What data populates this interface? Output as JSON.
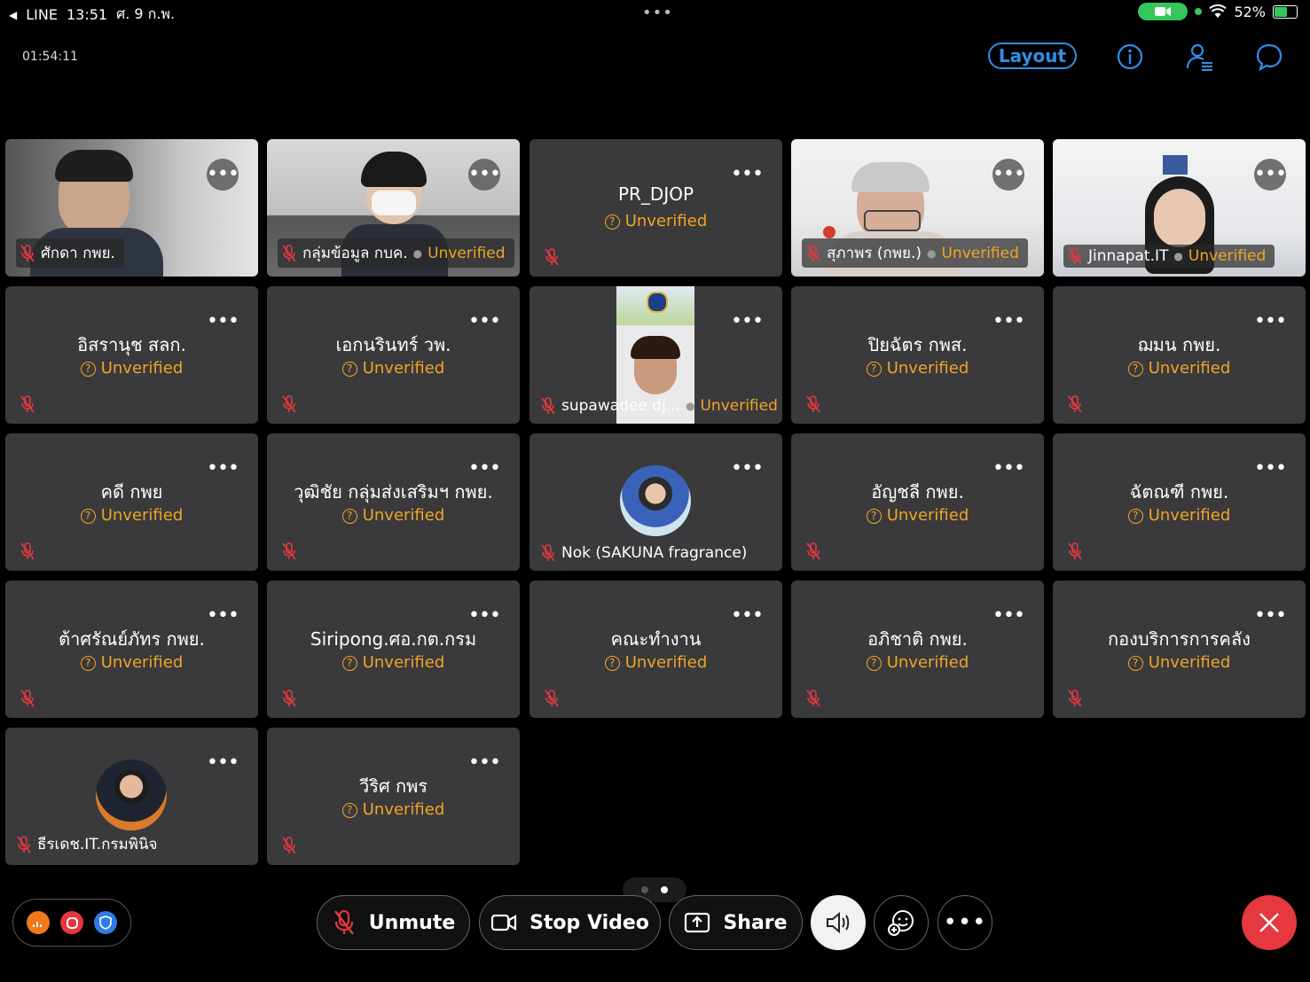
{
  "status_bar": {
    "app": "LINE",
    "time": "13:51",
    "date": "ศ. 9 ก.พ.",
    "battery": "52%"
  },
  "meeting": {
    "duration": "01:54:11",
    "layout_label": "Layout"
  },
  "unverified_label": "Unverified",
  "tiles": [
    {
      "name": "ศักดา กพย.",
      "kind": "video",
      "verified": true
    },
    {
      "name": "กลุ่มข้อมูล กบค.",
      "kind": "video",
      "verified": false
    },
    {
      "name": "PR_DJOP",
      "kind": "noVideo",
      "verified": false
    },
    {
      "name": "สุภาพร (กพย.)",
      "kind": "video",
      "verified": false
    },
    {
      "name": "Jinnapat.IT",
      "kind": "video",
      "verified": false
    },
    {
      "name": "อิสรานุช สลก.",
      "kind": "noVideo",
      "verified": false
    },
    {
      "name": "เอกนรินทร์ วพ.",
      "kind": "noVideo",
      "verified": false
    },
    {
      "name": "supawadee dj...",
      "kind": "video",
      "verified": false
    },
    {
      "name": "ปิยฉัตร กพส.",
      "kind": "noVideo",
      "verified": false
    },
    {
      "name": "ฌมน กพย.",
      "kind": "noVideo",
      "verified": false
    },
    {
      "name": "คดี กพย",
      "kind": "noVideo",
      "verified": false
    },
    {
      "name": "วุฒิชัย กลุ่มส่งเสริมฯ กพย.",
      "kind": "noVideo",
      "verified": false
    },
    {
      "name": "Nok (SAKUNA fragrance)",
      "kind": "avatar",
      "verified": true
    },
    {
      "name": "อัญชลี กพย.",
      "kind": "noVideo",
      "verified": false
    },
    {
      "name": "ฉัตณฑี กพย.",
      "kind": "noVideo",
      "verified": false
    },
    {
      "name": "ต้าศรัณย์ภัทร กพย.",
      "kind": "noVideo",
      "verified": false
    },
    {
      "name": "Siripong.ศอ.กต.กรม",
      "kind": "noVideo",
      "verified": false
    },
    {
      "name": "คณะทำงาน",
      "kind": "noVideo",
      "verified": false
    },
    {
      "name": "อภิชาติ กพย.",
      "kind": "noVideo",
      "verified": false
    },
    {
      "name": "กองบริการการคลัง",
      "kind": "noVideo",
      "verified": false
    },
    {
      "name": "ธีรเดช.IT.กรมพินิจ",
      "kind": "avatar",
      "verified": true
    },
    {
      "name": "วีริศ กพร",
      "kind": "noVideo",
      "verified": false
    }
  ],
  "controls": {
    "unmute": "Unmute",
    "stop_video": "Stop Video",
    "share": "Share"
  },
  "pagination": {
    "pages": 2,
    "current": 2
  },
  "colors": {
    "accent": "#2f8fe8",
    "unverified": "#f0a426",
    "leave": "#e5383f",
    "mute": "#e5383f",
    "tile": "#3a3a3c"
  }
}
